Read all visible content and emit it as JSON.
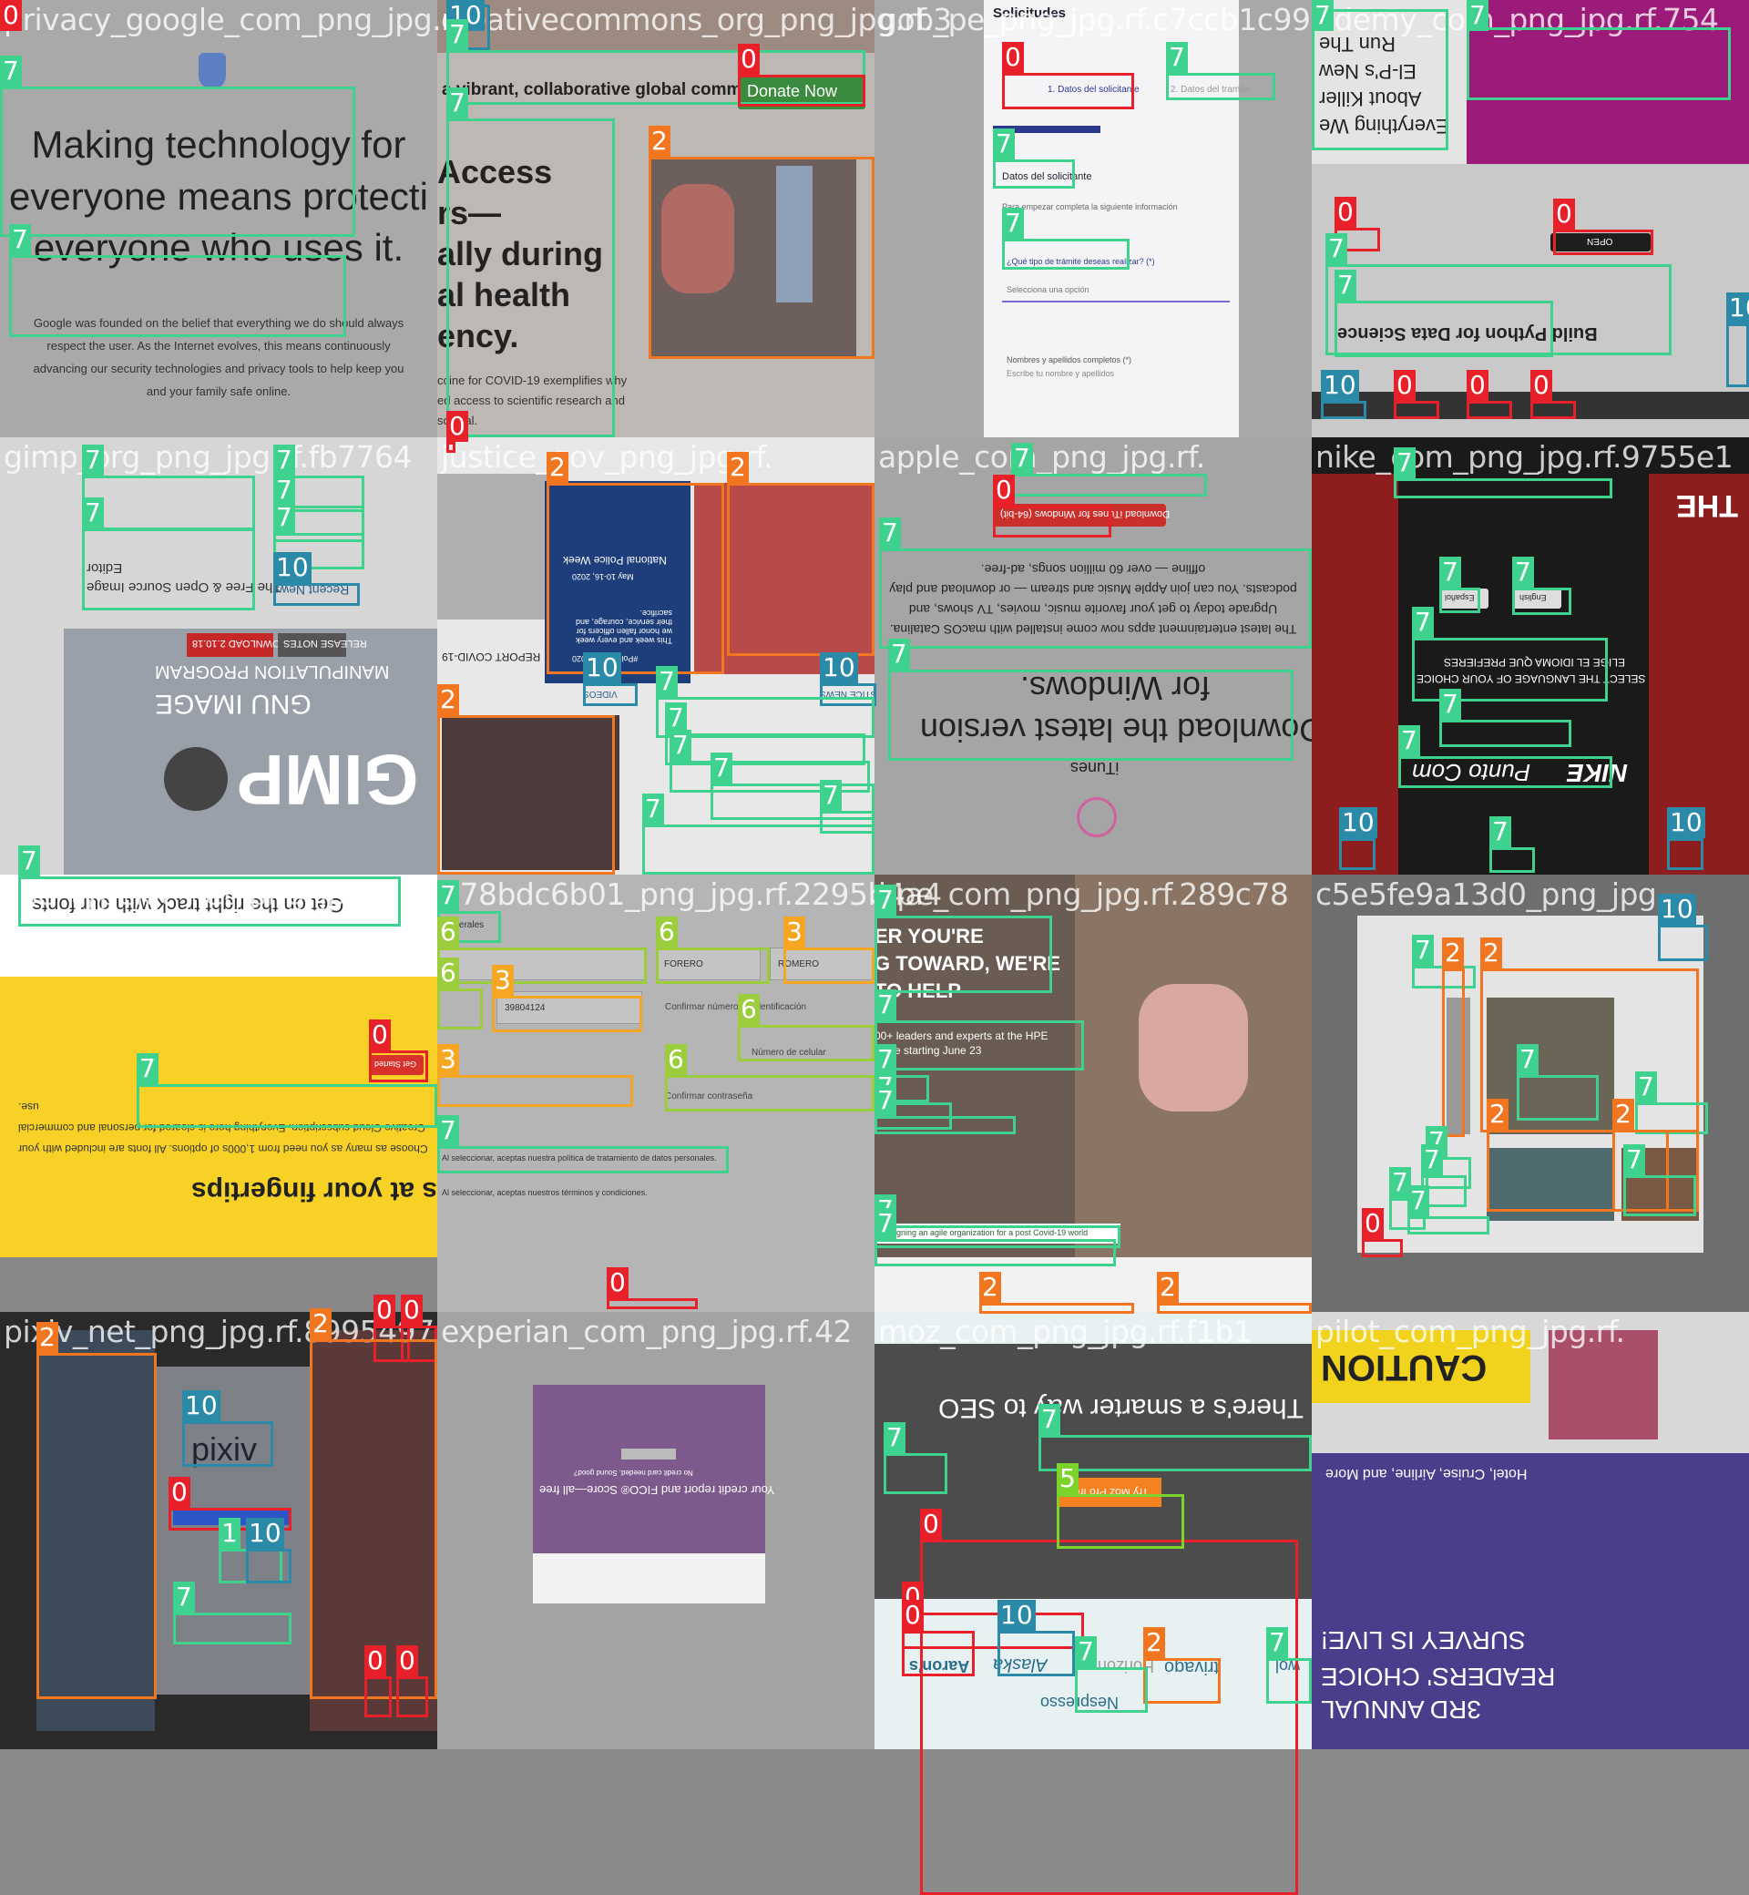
{
  "tiles": [
    {
      "name": "privacy_google_com_png_jpg.rf.",
      "texts": [
        "Making technology for",
        "everyone means protecting",
        "everyone who uses it.",
        "Google was founded on the belief that everything we do should always respect the user. As the Internet evolves, this means continuously advancing our security technologies and privacy tools to help keep you and your family safe online."
      ]
    },
    {
      "name": "creativecommons_org_png_jpg.rf.3",
      "texts": [
        "a vibrant, collaborative global commons",
        "Donate Now",
        "Access",
        "rs—",
        "ally during",
        "al health",
        "ency.",
        "ccine for COVID-19 exemplifies why",
        "ed access to scientific research and",
        "so vital."
      ]
    },
    {
      "name": "gob_pe_png_jpg.rf.c7ccb1c99",
      "texts": [
        "Solicitudes",
        "1. Datos del solicitante",
        "2. Datos del tramite",
        "Datos del solicitante",
        "Para empezar completa la siguiente información",
        "¿Qué tipo de trámite deseas realizar? (*)",
        "Selecciona una opción",
        "Nombres y apellidos completos (*)",
        "Escribe tu nombre y apellidos"
      ]
    },
    {
      "name": "udemy_com_png_jpg.rf.754",
      "texts": [
        "Everything We",
        "About Killer",
        "El-P's New",
        "Run The",
        "Build Python for Data Science",
        "OPEN"
      ]
    },
    {
      "name": "gimp_org_png_jpg.rf.fb7764",
      "texts": [
        "The Free & Open Source Image",
        "Editor",
        "Recent News",
        "DOWNLOAD 2.10.18",
        "RELEASE NOTES",
        "GNU IMAGE",
        "MANIPULATION PROGRAM",
        "GIMP"
      ]
    },
    {
      "name": "justice_gov_png_jpg.rf.",
      "texts": [
        "REPORT COVID-19",
        "National Police Week",
        "May 10-16, 2020",
        "This week and every week we honor fallen officers for their service, courage, and sacrifice.",
        "#PoliceWeek2020",
        "VIDEOS",
        "JUSTICE NEWS"
      ]
    },
    {
      "name": "apple_com_png_jpg.rf.",
      "texts": [
        "Download iTunes for Windows (64-bit)",
        "Download the latest version",
        "for Windows.",
        "The latest entertainment apps now come installed with macOS Catalina. Upgrade today to get your favorite music, movies, TV shows, and podcasts. You can join Apple Music and stream — or download and play offline — over 60 million songs, ad-free.",
        "iTunes"
      ]
    },
    {
      "name": "nike_com_png_jpg.rf.9755e1",
      "texts": [
        "THE",
        "SELECT THE LANGUAGE OF YOUR CHOICE",
        "ELIGE EL IDIOMA QUE PREFIERES",
        "NIKE",
        "Punto Com",
        "Español",
        "English"
      ]
    },
    {
      "name": "use_typekit_net_png_jpg.rf.",
      "texts": [
        "Get on the right track with our fonts",
        "Get Started",
        "y fonts at your fingertips",
        "Choose as many as you need from 1,000s of options. All fonts are included with your Creative Cloud subscription. Everything here is cleared for personal and commercial use."
      ]
    },
    {
      "name": "b78bdc6b01_png_jpg.rf.2295b4a4",
      "texts": [
        "Generales",
        "FORERO",
        "ROMERO",
        "39804124",
        "Confirmar número de identificación",
        "Número de celular",
        "Confirmar contraseña",
        "Al seleccionar, aceptas nuestra política de tratamiento de datos personales.",
        "Al seleccionar, aceptas nuestros términos y condiciones."
      ]
    },
    {
      "name": "hpe_com_png_jpg.rf.289c78",
      "texts": [
        "ER YOU'RE",
        "G TOWARD, WE'RE",
        "TO HELP",
        "00+ leaders and experts at the HPE",
        "ience starting June 23",
        "Designing an agile organization for a post Covid-19 world"
      ]
    },
    {
      "name": "c5e5fe9a13d0_png_jpg",
      "texts": []
    },
    {
      "name": "pixiv_net_png_jpg.rf.8995497",
      "texts": [
        "pixiv"
      ]
    },
    {
      "name": "experian_com_png_jpg.rf.42",
      "texts": [
        "Your credit report and FICO® Score—all free",
        "No credit card needed. Sound good?"
      ]
    },
    {
      "name": "moz_com_png_jpg.rf.f1b1",
      "texts": [
        "There's a smarter way to SEO",
        "Try Moz Pro free",
        "Aaron's",
        "Alaska",
        "trivago",
        "Horizon",
        "wol",
        "Nespresso"
      ]
    },
    {
      "name": "pilot_com_png_jpg.rf.",
      "texts": [
        "CAUTION",
        "Hotel, Cruise, Airline, and More",
        "READERS' CHOICE",
        "SURVEY IS LIVE!",
        "3RD ANNUAL"
      ]
    }
  ],
  "detections": [
    {
      "tile": 0,
      "label": "0"
    },
    {
      "tile": 0,
      "label": "7"
    },
    {
      "tile": 0,
      "label": "7"
    },
    {
      "tile": 1,
      "label": "10"
    },
    {
      "tile": 1,
      "label": "7"
    },
    {
      "tile": 1,
      "label": "0"
    },
    {
      "tile": 1,
      "label": "7"
    },
    {
      "tile": 1,
      "label": "2"
    },
    {
      "tile": 1,
      "label": "0"
    },
    {
      "tile": 2,
      "label": "0"
    },
    {
      "tile": 2,
      "label": "7"
    },
    {
      "tile": 2,
      "label": "7"
    },
    {
      "tile": 2,
      "label": "7"
    },
    {
      "tile": 3,
      "label": "7"
    },
    {
      "tile": 3,
      "label": "7"
    },
    {
      "tile": 3,
      "label": "0"
    },
    {
      "tile": 3,
      "label": "0"
    },
    {
      "tile": 3,
      "label": "7"
    },
    {
      "tile": 3,
      "label": "7"
    },
    {
      "tile": 3,
      "label": "10"
    },
    {
      "tile": 3,
      "label": "0"
    },
    {
      "tile": 3,
      "label": "0"
    },
    {
      "tile": 3,
      "label": "0"
    },
    {
      "tile": 3,
      "label": "10"
    },
    {
      "tile": 4,
      "label": "7"
    },
    {
      "tile": 4,
      "label": "7"
    },
    {
      "tile": 4,
      "label": "7"
    },
    {
      "tile": 4,
      "label": "7"
    },
    {
      "tile": 4,
      "label": "7"
    },
    {
      "tile": 4,
      "label": "10"
    },
    {
      "tile": 5,
      "label": "2"
    },
    {
      "tile": 5,
      "label": "2"
    },
    {
      "tile": 5,
      "label": "10"
    },
    {
      "tile": 5,
      "label": "10"
    },
    {
      "tile": 5,
      "label": "2"
    },
    {
      "tile": 5,
      "label": "7"
    },
    {
      "tile": 5,
      "label": "7"
    },
    {
      "tile": 5,
      "label": "7"
    },
    {
      "tile": 5,
      "label": "7"
    },
    {
      "tile": 5,
      "label": "7"
    },
    {
      "tile": 5,
      "label": "7"
    },
    {
      "tile": 6,
      "label": "7"
    },
    {
      "tile": 6,
      "label": "0"
    },
    {
      "tile": 6,
      "label": "7"
    },
    {
      "tile": 6,
      "label": "7"
    },
    {
      "tile": 7,
      "label": "7"
    },
    {
      "tile": 7,
      "label": "7"
    },
    {
      "tile": 7,
      "label": "7"
    },
    {
      "tile": 7,
      "label": "7"
    },
    {
      "tile": 7,
      "label": "7"
    },
    {
      "tile": 7,
      "label": "7"
    },
    {
      "tile": 7,
      "label": "10"
    },
    {
      "tile": 7,
      "label": "7"
    },
    {
      "tile": 7,
      "label": "10"
    },
    {
      "tile": 8,
      "label": "7"
    },
    {
      "tile": 8,
      "label": "0"
    },
    {
      "tile": 8,
      "label": "7"
    },
    {
      "tile": 9,
      "label": "7"
    },
    {
      "tile": 9,
      "label": "6"
    },
    {
      "tile": 9,
      "label": "6"
    },
    {
      "tile": 9,
      "label": "3"
    },
    {
      "tile": 9,
      "label": "6"
    },
    {
      "tile": 9,
      "label": "3"
    },
    {
      "tile": 9,
      "label": "6"
    },
    {
      "tile": 9,
      "label": "3"
    },
    {
      "tile": 9,
      "label": "6"
    },
    {
      "tile": 9,
      "label": "7"
    },
    {
      "tile": 9,
      "label": "0"
    },
    {
      "tile": 10,
      "label": "7"
    },
    {
      "tile": 10,
      "label": "7"
    },
    {
      "tile": 10,
      "label": "7"
    },
    {
      "tile": 10,
      "label": "7"
    },
    {
      "tile": 10,
      "label": "7"
    },
    {
      "tile": 10,
      "label": "7"
    },
    {
      "tile": 10,
      "label": "7"
    },
    {
      "tile": 10,
      "label": "2"
    },
    {
      "tile": 10,
      "label": "2"
    },
    {
      "tile": 11,
      "label": "10"
    },
    {
      "tile": 11,
      "label": "7"
    },
    {
      "tile": 11,
      "label": "2"
    },
    {
      "tile": 11,
      "label": "2"
    },
    {
      "tile": 11,
      "label": "7"
    },
    {
      "tile": 11,
      "label": "7"
    },
    {
      "tile": 11,
      "label": "7"
    },
    {
      "tile": 11,
      "label": "2"
    },
    {
      "tile": 11,
      "label": "2"
    },
    {
      "tile": 11,
      "label": "7"
    },
    {
      "tile": 11,
      "label": "7"
    },
    {
      "tile": 11,
      "label": "7"
    },
    {
      "tile": 11,
      "label": "7"
    },
    {
      "tile": 11,
      "label": "0"
    },
    {
      "tile": 12,
      "label": "0"
    },
    {
      "tile": 12,
      "label": "0"
    },
    {
      "tile": 12,
      "label": "2"
    },
    {
      "tile": 12,
      "label": "2"
    },
    {
      "tile": 12,
      "label": "10"
    },
    {
      "tile": 12,
      "label": "0"
    },
    {
      "tile": 12,
      "label": "1"
    },
    {
      "tile": 12,
      "label": "10"
    },
    {
      "tile": 12,
      "label": "7"
    },
    {
      "tile": 12,
      "label": "0"
    },
    {
      "tile": 12,
      "label": "0"
    },
    {
      "tile": 13,
      "label": "0"
    },
    {
      "tile": 13,
      "label": "7"
    },
    {
      "tile": 13,
      "label": "7"
    },
    {
      "tile": 13,
      "label": "5"
    },
    {
      "tile": 13,
      "label": "0"
    },
    {
      "tile": 13,
      "label": "0"
    },
    {
      "tile": 13,
      "label": "10"
    },
    {
      "tile": 14,
      "label": "2"
    },
    {
      "tile": 14,
      "label": "7"
    },
    {
      "tile": 14,
      "label": "7"
    },
    {
      "tile": 14,
      "label": "0"
    },
    {
      "tile": 14,
      "label": "7"
    },
    {
      "tile": 14,
      "label": "10"
    },
    {
      "tile": 14,
      "label": "10"
    },
    {
      "tile": 14,
      "label": "0"
    },
    {
      "tile": 14,
      "label": "10"
    },
    {
      "tile": 14,
      "label": "7"
    },
    {
      "tile": 15,
      "label": "7"
    },
    {
      "tile": 15,
      "label": "2"
    }
  ]
}
